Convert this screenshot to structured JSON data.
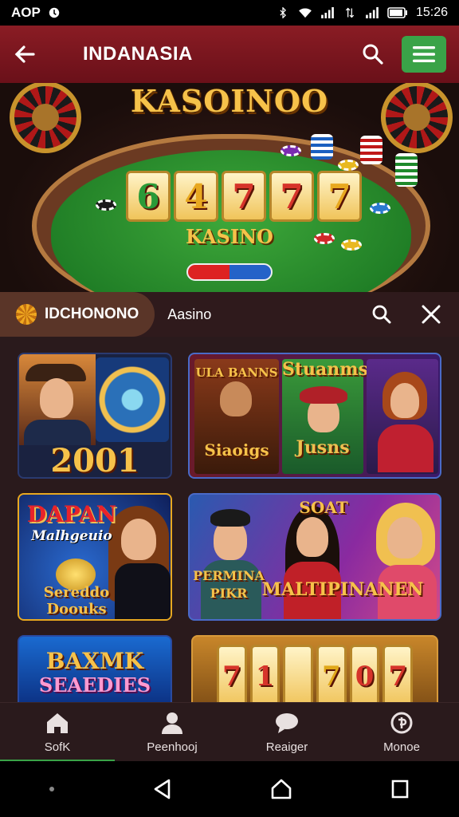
{
  "status": {
    "left_text": "AOP",
    "time": "15:26"
  },
  "appbar": {
    "title": "INDANASIA"
  },
  "hero": {
    "title": "KASOINOO",
    "reels": [
      "6",
      "4",
      "7",
      "7",
      "7"
    ],
    "subtitle": "KASINO"
  },
  "filter": {
    "brand": "IDCHONONO",
    "label": "Aasino"
  },
  "cards": [
    {
      "caption": "2001"
    },
    {
      "top": "Stuanms",
      "title": "Siaoigs",
      "sub": "Jusns",
      "tag": "ULA BANNS"
    },
    {
      "title": "DAPAN",
      "sub": "Malhgeuio",
      "caption": "Sereddo Doouks"
    },
    {
      "title": "SOAT",
      "sub": "PERMINA",
      "sub2": "PIKR",
      "caption": "MALTIPINANEN"
    },
    {
      "title": "BAXMK",
      "caption": "SEAEDIES"
    },
    {
      "reels": [
        "7",
        "1",
        "",
        "7",
        "0",
        "7"
      ]
    }
  ],
  "bottom_nav": [
    {
      "label": "SofK",
      "icon": "home-icon"
    },
    {
      "label": "Peenhooj",
      "icon": "profile-icon"
    },
    {
      "label": "Reaiger",
      "icon": "chat-icon"
    },
    {
      "label": "Monoe",
      "icon": "wallet-icon"
    }
  ],
  "colors": {
    "appbar": "#7a1620",
    "accent_green": "#3aa348",
    "gold": "#f6c24a"
  }
}
